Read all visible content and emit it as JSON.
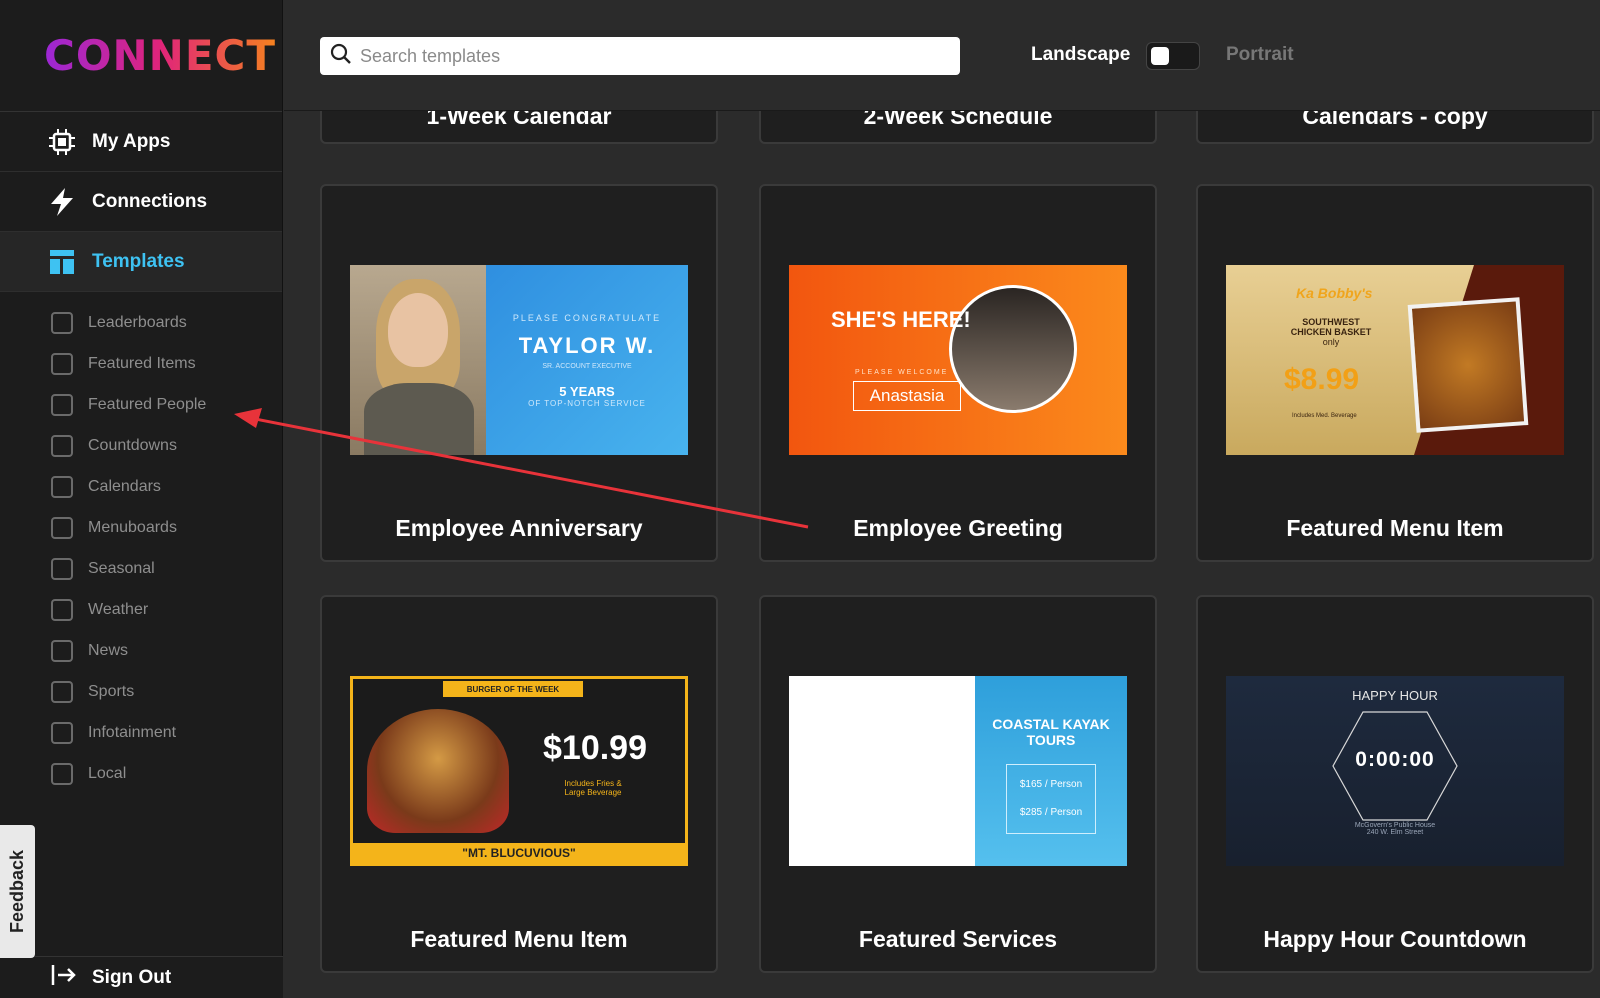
{
  "brand": {
    "logo": "CONNECT"
  },
  "nav": [
    {
      "label": "My Apps",
      "icon": "chip-icon"
    },
    {
      "label": "Connections",
      "icon": "bolt-icon"
    },
    {
      "label": "Templates",
      "icon": "templates-icon",
      "active": true
    }
  ],
  "filters": [
    "Leaderboards",
    "Featured Items",
    "Featured People",
    "Countdowns",
    "Calendars",
    "Menuboards",
    "Seasonal",
    "Weather",
    "News",
    "Sports",
    "Infotainment",
    "Local"
  ],
  "feedback": "Feedback",
  "signout": "Sign Out",
  "search": {
    "placeholder": "Search templates",
    "value": ""
  },
  "orientation": {
    "landscape": "Landscape",
    "portrait": "Portrait",
    "selected": "Landscape"
  },
  "partial_cards": [
    "1-Week Calendar",
    "2-Week Schedule",
    "Calendars - copy"
  ],
  "cards": [
    {
      "title": "Employee Anniversary",
      "thumb": {
        "line1": "PLEASE CONGRATULATE",
        "name": "TAYLOR W.",
        "role": "SR. ACCOUNT EXECUTIVE",
        "years": "5 YEARS",
        "sub": "OF TOP-NOTCH SERVICE"
      }
    },
    {
      "title": "Employee Greeting",
      "thumb": {
        "headline": "SHE'S HERE!",
        "welcome": "PLEASE WELCOME",
        "name": "Anastasia"
      }
    },
    {
      "title": "Featured Menu Item",
      "thumb": {
        "brand": "Ka Bobby's",
        "item": "SOUTHWEST CHICKEN BASKET",
        "only": "only",
        "price": "$8.99",
        "note": "Includes Med. Beverage"
      }
    },
    {
      "title": "Featured Menu Item",
      "thumb": {
        "tag": "BURGER OF THE WEEK",
        "price": "$10.99",
        "note": "Includes Fries & Large Beverage",
        "name": "\"MT. BLUCUVIOUS\""
      }
    },
    {
      "title": "Featured Services",
      "thumb": {
        "line1": "COASTAL KAYAK",
        "line2": "TOURS",
        "price1": "$165 / Person",
        "price2": "$285 / Person"
      }
    },
    {
      "title": "Happy Hour Countdown",
      "thumb": {
        "label": "HAPPY HOUR",
        "time": "0:00:00",
        "place": "McGovern's Public House",
        "address": "240 W. Elm Street"
      }
    }
  ],
  "colors": {
    "accent": "#3ec2f2",
    "arrow": "#e8333a"
  }
}
